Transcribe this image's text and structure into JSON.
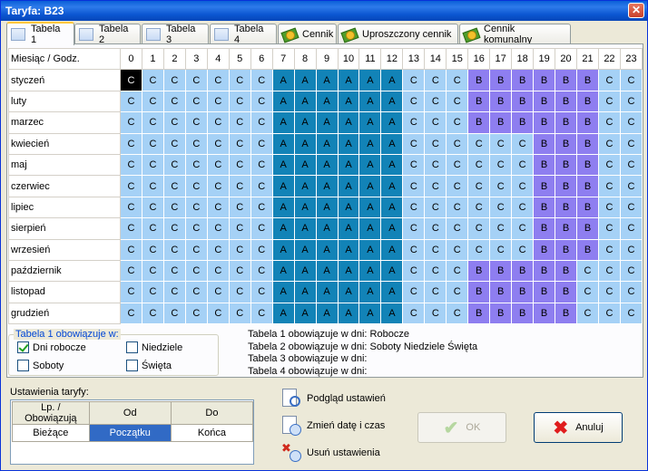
{
  "window": {
    "title": "Taryfa: B23",
    "close_glyph": "✕"
  },
  "tabs": [
    {
      "label": "Tabela 1",
      "icon": "table-icon",
      "active": true
    },
    {
      "label": "Tabela 2",
      "icon": "table-icon"
    },
    {
      "label": "Tabela 3",
      "icon": "table-icon"
    },
    {
      "label": "Tabela 4",
      "icon": "table-icon"
    },
    {
      "label": "Cennik",
      "icon": "money-icon"
    },
    {
      "label": "Uproszczony cennik",
      "icon": "money-icon"
    },
    {
      "label": "Cennik komunalny",
      "icon": "money-icon"
    }
  ],
  "grid": {
    "corner_label": "Miesiąc / Godz.",
    "hours": [
      "0",
      "1",
      "2",
      "3",
      "4",
      "5",
      "6",
      "7",
      "8",
      "9",
      "10",
      "11",
      "12",
      "13",
      "14",
      "15",
      "16",
      "17",
      "18",
      "19",
      "20",
      "21",
      "22",
      "23"
    ],
    "months": [
      {
        "name": "styczeń",
        "cells": "CCCCCCCAAAAAACCCBBBBBBCC"
      },
      {
        "name": "luty",
        "cells": "CCCCCCCAAAAAACCCBBBBBBCC"
      },
      {
        "name": "marzec",
        "cells": "CCCCCCCAAAAAACCCBBBBBBCC"
      },
      {
        "name": "kwiecień",
        "cells": "CCCCCCCAAAAAACCCCCCBBBCC"
      },
      {
        "name": "maj",
        "cells": "CCCCCCCAAAAAACCCCCCBBBCC"
      },
      {
        "name": "czerwiec",
        "cells": "CCCCCCCAAAAAACCCCCCBBBCC"
      },
      {
        "name": "lipiec",
        "cells": "CCCCCCCAAAAAACCCCCCBBBCC"
      },
      {
        "name": "sierpień",
        "cells": "CCCCCCCAAAAAACCCCCCBBBCC"
      },
      {
        "name": "wrzesień",
        "cells": "CCCCCCCAAAAAACCCCCCBBBCC"
      },
      {
        "name": "październik",
        "cells": "CCCCCCCAAAAAACCCBBBBBCCC"
      },
      {
        "name": "listopad",
        "cells": "CCCCCCCAAAAAACCCBBBBBCCC"
      },
      {
        "name": "grudzień",
        "cells": "CCCCCCCAAAAAACCCBBBBBCCC"
      }
    ],
    "selected_cell": {
      "month_index": 0,
      "hour_index": 0
    },
    "colors": {
      "C": "#a5d1f6",
      "A": "#1283b7",
      "B": "#8e7ef0",
      "selected": "#000000"
    }
  },
  "applies": {
    "legend": "Tabela 1 obowiązuje w:",
    "dni_robocze": {
      "label": "Dni robocze",
      "checked": true
    },
    "niedziele": {
      "label": "Niedziele",
      "checked": false
    },
    "soboty": {
      "label": "Soboty",
      "checked": false
    },
    "swieta": {
      "label": "Święta",
      "checked": false
    }
  },
  "info_lines": [
    "Tabela 1 obowiązuje w dni: Robocze",
    "Tabela 2 obowiązuje w dni: Soboty Niedziele Święta",
    "Tabela 3 obowiązuje w dni:",
    "Tabela 4 obowiązuje w dni:"
  ],
  "settings": {
    "label": "Ustawienia taryfy:",
    "col_lp": "Lp. / Obowiązują",
    "col_od": "Od",
    "col_do": "Do",
    "row_label": "Bieżące",
    "row_od": "Początku",
    "row_do": "Końca"
  },
  "actions": {
    "preview": "Podgląd ustawień",
    "change_date": "Zmień datę i czas",
    "delete": "Usuń ustawienia"
  },
  "buttons": {
    "ok": "OK",
    "cancel": "Anuluj"
  }
}
